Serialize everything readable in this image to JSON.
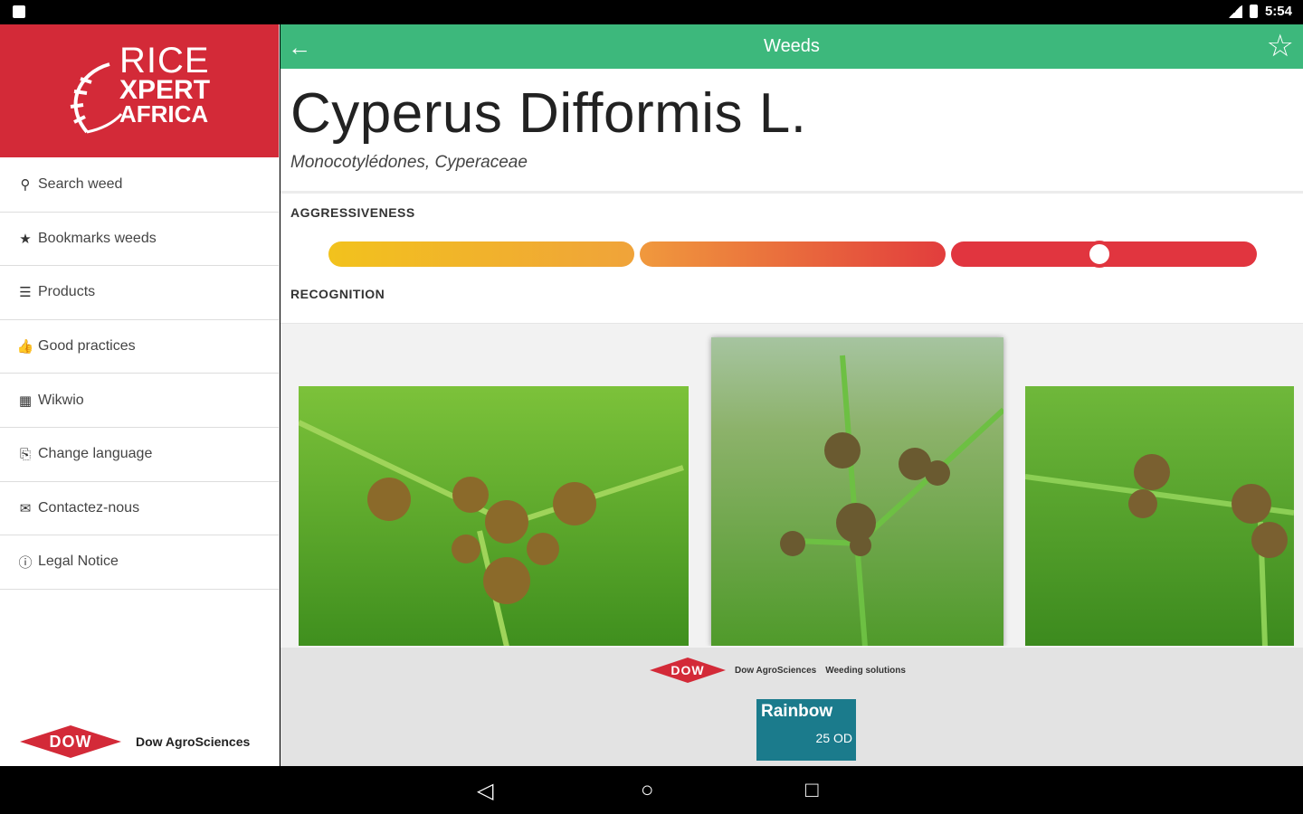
{
  "status": {
    "time": "5:54"
  },
  "sidebar": {
    "logo": {
      "line1": "RICE",
      "line2": "XPERT",
      "line3": "AFRICA"
    },
    "items": [
      {
        "icon": "search-icon",
        "glyph": "⚲",
        "label": "Search weed"
      },
      {
        "icon": "star-icon",
        "glyph": "★",
        "label": "Bookmarks weeds"
      },
      {
        "icon": "list-icon",
        "glyph": "☰",
        "label": "Products"
      },
      {
        "icon": "thumbs-up-icon",
        "glyph": "👍",
        "label": "Good practices"
      },
      {
        "icon": "book-icon",
        "glyph": "▦",
        "label": "Wikwio"
      },
      {
        "icon": "language-icon",
        "glyph": "⎘",
        "label": "Change language"
      },
      {
        "icon": "envelope-icon",
        "glyph": "✉",
        "label": "Contactez-nous"
      },
      {
        "icon": "info-icon",
        "glyph": "ⓘ",
        "label": "Legal Notice"
      }
    ],
    "footer": {
      "logo": "DOW",
      "brand": "Dow AgroSciences"
    }
  },
  "toolbar": {
    "title": "Weeds",
    "back_glyph": "←",
    "star_glyph": "☆"
  },
  "weed": {
    "name": "Cyperus Difformis L.",
    "family": "Monocotylédones, Cyperaceae",
    "aggressiveness_title": "AGGRESSIVENESS",
    "aggressiveness_level": 0.83,
    "recognition_title": "RECOGNITION"
  },
  "ad": {
    "logo": "DOW",
    "company": "Dow AgroSciences",
    "tagline": "Weeding solutions",
    "product": "Rainbow",
    "dose": "25 OD"
  },
  "colors": {
    "toolbar": "#3db87c",
    "brand_red": "#d32a38",
    "aggr_low": "#f2c21d",
    "aggr_high": "#e1353f"
  },
  "navbar": {
    "back": "◁",
    "home": "○",
    "recents": "□"
  }
}
